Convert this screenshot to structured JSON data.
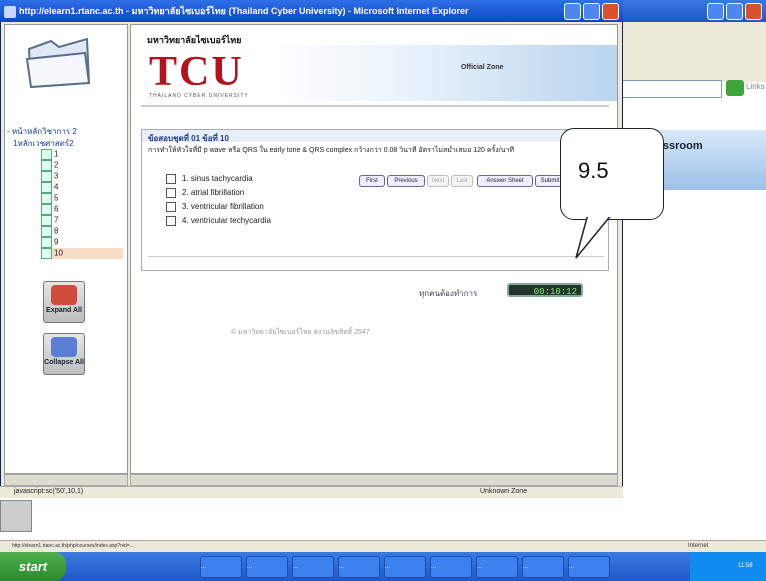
{
  "main_window": {
    "title": "http://elearn1.rtanc.ac.th - มหาวิทยาลัยไซเบอร์ไทย (Thailand Cyber University) - Microsoft Internet Explorer"
  },
  "header": {
    "university_name": "มหาวิทยาลัยไซเบอร์ไทย",
    "logo_text": "TCU",
    "logo_subtitle": "THAILAND CYBER UNIVERSITY",
    "zone_text": "Official Zone"
  },
  "left_tree": {
    "root_label": "- หน้าหลักวิชาการ 2",
    "sub_label": "1หลักเวชศาสตร์2",
    "items": [
      "1",
      "2",
      "3",
      "4",
      "5",
      "6",
      "7",
      "8",
      "9",
      "10"
    ],
    "selected_index": 9,
    "expand_all": "Expand All",
    "collapse_all": "Collapse All"
  },
  "question": {
    "meta": "ข้อสอบชุดที่ 01   ข้อที่  10",
    "text": "การทำให้หัวใจที่มี p wave หรือ QRS ใน early tone & QRS complex กว้างกว่า 0.08 วินาที อัตราไม่สม่ำเสมอ 120 ครั้ง/นาที",
    "options": [
      "1.  sinus tachycardia",
      "2.  atrial fibrillation",
      "3.  ventricular fibrillation",
      "4.  ventricular techycardia"
    ],
    "buttons": [
      "First",
      "Previous",
      "Next",
      "Last",
      "Answer Sheet",
      "Submit"
    ]
  },
  "timer": {
    "label": "ทุกคนต้องทำการ",
    "value": "00:10:12"
  },
  "footer_copyright": "© มหาวิทยาลัยไซเบอร์ไทย สงวนลิขสิทธิ์ 2547",
  "callout": {
    "value": "9.5"
  },
  "statusbar": {
    "left": "javascript:sc('50',10,1)",
    "zone": "Unknown Zone"
  },
  "ie_status2": {
    "url": "http://elearn1.rtanc.ac.th/php/courses/index.asp?nid=...",
    "zone": "Internet"
  },
  "background_window": {
    "heading": "e-Classroom",
    "go_label": "Go",
    "links_label": "Links"
  },
  "taskbar": {
    "start": "start",
    "tasks": [
      "...",
      "...",
      "...",
      "...",
      "...",
      "...",
      "...",
      "...",
      "..."
    ],
    "clock": "11:58"
  }
}
